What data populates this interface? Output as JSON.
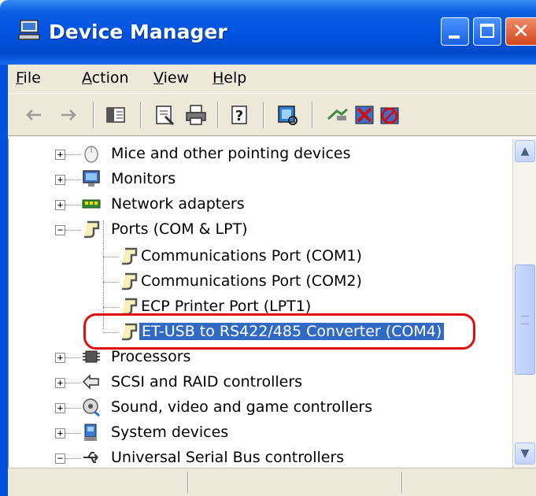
{
  "window": {
    "title": "Device Manager",
    "controls": {
      "minimize": "minimize",
      "maximize": "maximize",
      "close": "close"
    }
  },
  "menu": [
    {
      "label": "File",
      "underline": "F"
    },
    {
      "label": "Action",
      "underline": "A"
    },
    {
      "label": "View",
      "underline": "V"
    },
    {
      "label": "Help",
      "underline": "H"
    }
  ],
  "toolbar": {
    "buttons": [
      "back-icon",
      "forward-icon",
      "show-hide-tree-icon",
      "properties-icon",
      "print-icon",
      "help-icon",
      "scan-hardware-icon",
      "update-driver-icon",
      "uninstall-icon",
      "disable-icon"
    ]
  },
  "tree": {
    "rows": [
      {
        "label": "Mice and other pointing devices",
        "expander": "+",
        "icon": "mouse-icon"
      },
      {
        "label": "Monitors",
        "expander": "+",
        "icon": "monitor-icon"
      },
      {
        "label": "Network adapters",
        "expander": "+",
        "icon": "network-adapter-icon"
      },
      {
        "label": "Ports (COM & LPT)",
        "expander": "−",
        "icon": "port-icon"
      },
      {
        "label": "Communications Port (COM1)",
        "icon": "port-icon"
      },
      {
        "label": "Communications Port (COM2)",
        "icon": "port-icon"
      },
      {
        "label": "ECP Printer Port (LPT1)",
        "icon": "port-icon"
      },
      {
        "label": "ET-USB to RS422/485 Converter (COM4)",
        "icon": "port-icon",
        "selected": true
      },
      {
        "label": "Processors",
        "expander": "+",
        "icon": "processor-icon"
      },
      {
        "label": "SCSI and RAID controllers",
        "expander": "+",
        "icon": "scsi-icon"
      },
      {
        "label": "Sound, video and game controllers",
        "expander": "+",
        "icon": "sound-icon"
      },
      {
        "label": "System devices",
        "expander": "+",
        "icon": "system-device-icon"
      },
      {
        "label": "Universal Serial Bus controllers",
        "expander": "−",
        "icon": "usb-icon"
      }
    ]
  },
  "colors": {
    "titlebar": "#0054e3",
    "selection": "#316ac5",
    "highlight_ring": "#e01010",
    "chrome": "#ece9d8"
  }
}
